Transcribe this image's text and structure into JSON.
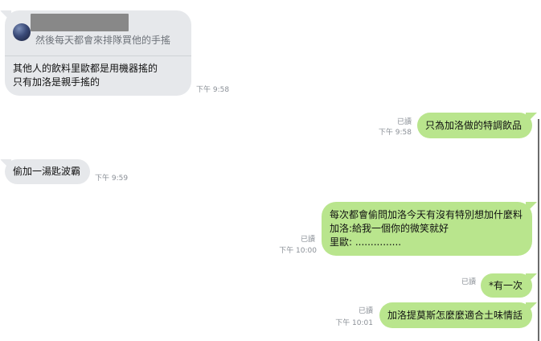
{
  "messages": [
    {
      "side": "left",
      "reply_preview": {
        "text": "然後每天都會來排隊買他的手搖"
      },
      "text": "其他人的飲料里歐都是用機器搖的\n只有加洛是親手搖的",
      "time": "下午 9:58"
    },
    {
      "side": "right",
      "read": "已讀",
      "text": "只為加洛做的特調飲品",
      "time": "下午 9:58"
    },
    {
      "side": "left",
      "text": "偷加一湯匙波霸",
      "time": "下午 9:59"
    },
    {
      "side": "right",
      "read": "已讀",
      "text": "每次都會偷問加洛今天有沒有特別想加什麼料\n加洛:給我一個你的微笑就好\n里歐: ...............",
      "time": "下午 10:00"
    },
    {
      "side": "right",
      "read": "已讀",
      "text": "*有一次",
      "time": ""
    },
    {
      "side": "right",
      "read": "已讀",
      "text": "加洛提莫斯怎麼麼適合土味情話",
      "time": "下午 10:01"
    }
  ],
  "colors": {
    "incoming_bubble": "#e6e8eb",
    "outgoing_bubble": "#b9e58d",
    "meta_text": "#8a8f96"
  },
  "icons": [
    "avatar"
  ]
}
